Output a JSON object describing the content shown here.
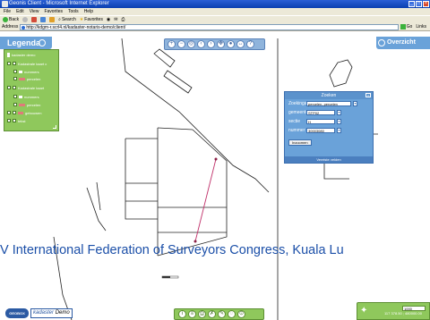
{
  "window": {
    "title": "Geonis Client - Microsoft Internet Explorer"
  },
  "menu": [
    "File",
    "Edit",
    "View",
    "Favorites",
    "Tools",
    "Help"
  ],
  "toolbar": {
    "back": "Back",
    "search": "Search",
    "favorites": "Favorites"
  },
  "address": {
    "label": "Address",
    "url": "http://kdgm-r.scrl4.nl/kadaster-notaris-demo/client/",
    "go": "Go",
    "links": "Links"
  },
  "legend": {
    "title": "Legenda",
    "items": [
      {
        "label": "kadaster demo",
        "color": "#ffffff"
      },
      {
        "label": "Kadastrale kaart c",
        "color": "#ffffff"
      },
      {
        "label": "nummers",
        "color": "#ffffff"
      },
      {
        "label": "percelen",
        "color": "#e07a7a"
      },
      {
        "label": "Kadastrale kaart",
        "color": "#ffffff"
      },
      {
        "label": "nummers",
        "color": "#ffffff"
      },
      {
        "label": "percelen",
        "color": "#e07a7a"
      },
      {
        "label": "gebouwen",
        "color": "#e07a7a"
      },
      {
        "label": "tekst",
        "color": "#ffffff"
      }
    ]
  },
  "map_tools": [
    "zoom-in",
    "zoom-out",
    "zoom-full",
    "zoom-prev",
    "zoom-next",
    "pan",
    "identify",
    "measure",
    "help"
  ],
  "overview": {
    "label": "Overzicht"
  },
  "search": {
    "title": "Zoeken",
    "rows": [
      {
        "label": "Zoekingang",
        "value": "percelen, percelen"
      },
      {
        "label": "gemeente",
        "value": "STP02"
      },
      {
        "label": "sectie",
        "value": "H"
      },
      {
        "label": "nummer",
        "value": "30003080"
      }
    ],
    "button": "Inzoomen",
    "footer": "Vereiste velden"
  },
  "overlay": {
    "congress_text": "V International Federation of Surveyors Congress, Kuala Lu"
  },
  "bottom": {
    "logo1": "GEOBOX",
    "logo2": "kadaster",
    "logo2_suffix": "Demo",
    "coords": "117 378.50 ; 480000.00",
    "scale": "1000"
  },
  "bottom_tools": [
    "info",
    "layers",
    "print",
    "clear",
    "redline",
    "erase",
    "zoom"
  ]
}
